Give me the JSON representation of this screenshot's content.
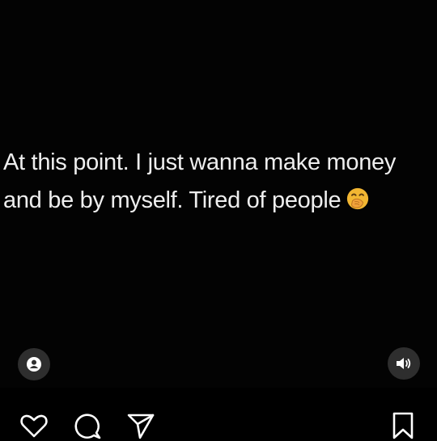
{
  "post": {
    "quote_line1": "At this point. I just wanna make money",
    "quote_line2": "and be by myself. Tired of people",
    "emoji_icon": "face-with-hand-over-mouth-emoji",
    "background_color": "#030303",
    "text_color": "#eeeeee"
  },
  "overlay": {
    "tags_icon": "user-tag-icon",
    "audio_icon": "speaker-on-icon"
  },
  "actions": {
    "like_icon": "heart-icon",
    "comment_icon": "comment-icon",
    "share_icon": "send-icon",
    "save_icon": "bookmark-icon"
  }
}
